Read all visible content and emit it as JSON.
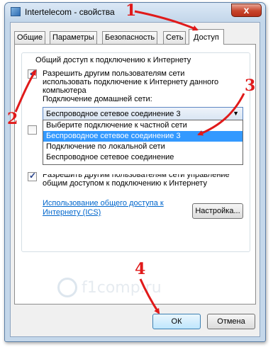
{
  "window": {
    "title": "Intertelecom - свойства",
    "close_label": "x"
  },
  "tabs": [
    "Общие",
    "Параметры",
    "Безопасность",
    "Сеть",
    "Доступ"
  ],
  "group": {
    "title": "Общий доступ к подключению к Интернету",
    "allow_label_1": "Разрешить другим пользователям сети",
    "allow_label_2": "использовать подключение к Интернету данного",
    "allow_label_3": "компьютера",
    "home_network_label": "Подключение домашней сети:",
    "combo_value": "Беспроводное сетевое соединение 3",
    "dropdown_options": [
      "Выберите подключение к частной сети",
      "Беспроводное сетевое соединение 3",
      "Подключение по локальной сети",
      "Беспроводное сетевое соединение"
    ],
    "control_label_1": "Разрешить другим пользователям сети управление",
    "control_label_2": "общим доступом к подключению к Интернету",
    "link_text": "Использование общего доступа к Интернету (ICS)",
    "settings_button": "Настройка..."
  },
  "footer": {
    "ok": "ОК",
    "cancel": "Отмена"
  },
  "watermark": "f1comp.ru",
  "annotations": [
    "1",
    "2",
    "3",
    "4"
  ],
  "colors": {
    "annotation": "#e01a1a",
    "selection": "#3399ff",
    "link": "#0066cc"
  }
}
